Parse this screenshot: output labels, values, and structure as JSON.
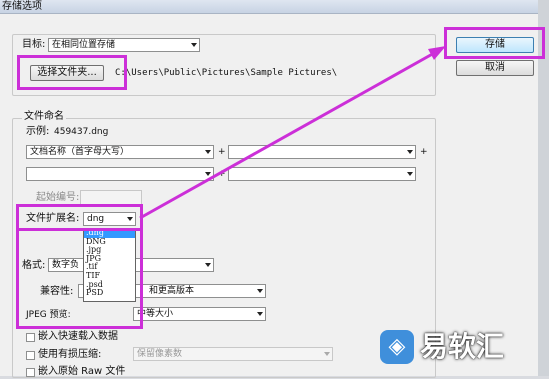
{
  "window": {
    "title": "存储选项"
  },
  "target": {
    "label": "目标:",
    "location_value": "在相同位置存储",
    "select_folder_button": "选择文件夹...",
    "path": "C:\\Users\\Public\\Pictures\\Sample Pictures\\"
  },
  "actions": {
    "save_button": "存储",
    "cancel_button": "取消"
  },
  "naming": {
    "group_title": "文件命名",
    "example_label": "示例:",
    "example_value": "459437.dng",
    "field1_value": "文档名称（首字母大写）",
    "plus": "+",
    "start_number_label": "起始编号:",
    "extension_label": "文件扩展名:",
    "extension_value": "dng",
    "extension_options": [
      ".dng",
      "DNG",
      ".jpg",
      "JPG",
      ".tif",
      "TIF",
      ".psd",
      "PSD"
    ]
  },
  "format": {
    "format_label": "格式:",
    "format_value": "数字负",
    "compat_label": "兼容性:",
    "compat_value": "和更高版本",
    "jpeg_preview_label": "JPEG 预览:",
    "jpeg_preview_value": "中等大小"
  },
  "options": {
    "embed_fast_load": "嵌入快速载入数据",
    "lossy_compression": "使用有损压缩:",
    "lossy_value": "保留像素数",
    "embed_raw": "嵌入原始 Raw 文件"
  },
  "watermark": {
    "text": "易软汇"
  },
  "colors": {
    "highlight": "#cc2fd8",
    "dialog_bg": "#f0f0f0",
    "selection": "#3399ff"
  }
}
